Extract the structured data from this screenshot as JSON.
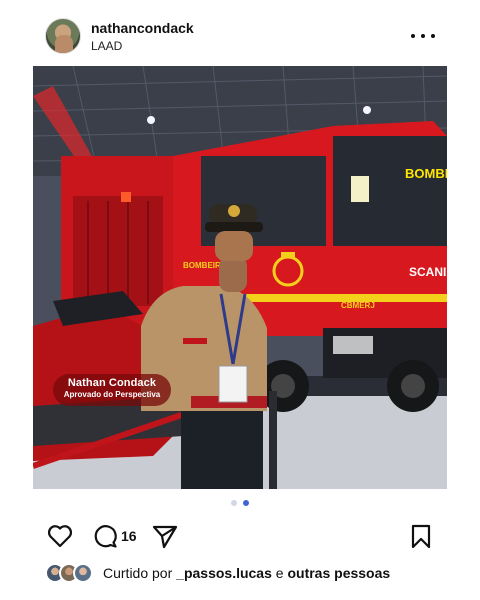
{
  "header": {
    "username": "nathancondack",
    "location": "LAAD"
  },
  "photo": {
    "caption_name": "Nathan Condack",
    "caption_subtitle": "Aprovado do Perspectiva",
    "truck_text_bombeiros": "BOMBEIROS",
    "truck_text_brand": "SCANIA",
    "truck_text_unit": "CBMERJ",
    "truck_text_windshield": "BOMBEIR"
  },
  "carousel": {
    "total_slides": 2,
    "active_slide": 2
  },
  "actions": {
    "comment_count": "16"
  },
  "likes": {
    "prefix": "Curtido por",
    "user": "_passos.lucas",
    "connector": "e",
    "others": "outras pessoas"
  },
  "icons": {
    "more": "more-horizontal-icon",
    "like": "heart-icon",
    "comment": "comment-icon",
    "share": "send-icon",
    "save": "bookmark-icon"
  },
  "colors": {
    "carousel_active": "#3f64d8",
    "carousel_inactive": "#cfd6e6",
    "truck_red": "#d7191f",
    "badge_bg": "#780a0a"
  }
}
